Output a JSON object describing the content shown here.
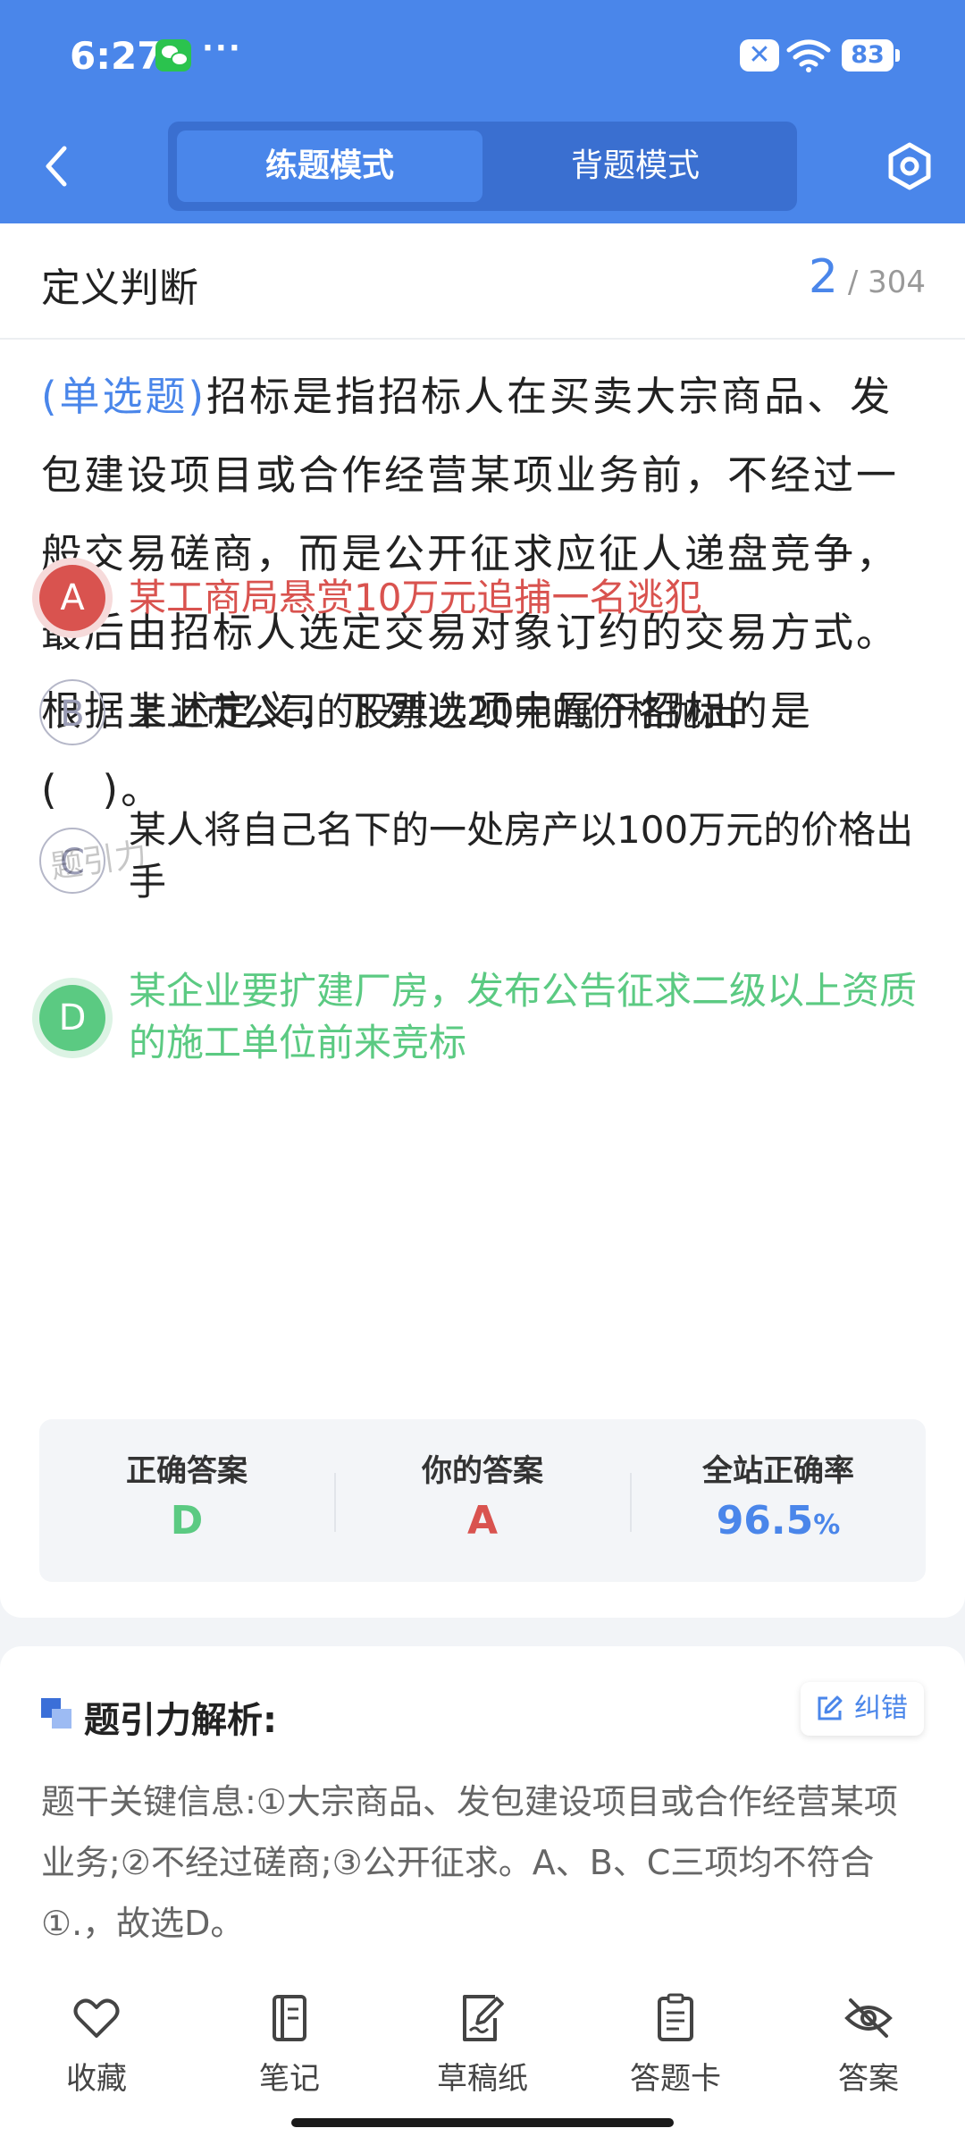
{
  "status_bar": {
    "time": "6:27",
    "dots": "···",
    "mute_icon": "✕",
    "battery": "83"
  },
  "header": {
    "tabs": [
      {
        "label": "练题模式",
        "active": true
      },
      {
        "label": "背题模式",
        "active": false
      }
    ]
  },
  "question": {
    "category": "定义判断",
    "index": "2",
    "total": "/ 304",
    "type_label": "(单选题)",
    "text": "招标是指招标人在买卖大宗商品、发包建设项目或合作经营某项业务前，不经过一般交易磋商，而是公开征求应征人递盘竞争，最后由招标人选定交易对象订约的交易方式。根据上述定义，下列选项中属于招标的是(　)。",
    "options": [
      {
        "letter": "A",
        "text": "某工商局悬赏10万元追捕一名逃犯",
        "state": "wrong"
      },
      {
        "letter": "B",
        "text": "某上市公司的股票以20元的价格抛出'",
        "state": "normal"
      },
      {
        "letter": "C",
        "text": "某人将自己名下的一处房产以100万元的价格出手",
        "state": "normal"
      },
      {
        "letter": "D",
        "text": "某企业要扩建厂房，发布公告征求二级以上资质的施工单位前来竞标",
        "state": "correct"
      }
    ],
    "watermark": "题引力"
  },
  "stats": {
    "correct_label": "正确答案",
    "correct_value": "D",
    "yours_label": "你的答案",
    "yours_value": "A",
    "rate_label": "全站正确率",
    "rate_value": "96.5",
    "rate_unit": "%"
  },
  "analysis": {
    "title": "题引力解析:",
    "correct_button": "纠错",
    "text": "题干关键信息:①大宗商品、发包建设项目或合作经营某项业务;②不经过磋商;③公开征求。A、B、C三项均不符合①.，故选D。"
  },
  "bottom_nav": [
    {
      "label": "收藏",
      "icon": "heart-icon"
    },
    {
      "label": "笔记",
      "icon": "notebook-icon"
    },
    {
      "label": "草稿纸",
      "icon": "draft-icon"
    },
    {
      "label": "答题卡",
      "icon": "answer-card-icon"
    },
    {
      "label": "答案",
      "icon": "eye-off-icon"
    }
  ],
  "colors": {
    "primary": "#4a86ea",
    "wrong": "#d9534f",
    "correct": "#5bca82"
  }
}
